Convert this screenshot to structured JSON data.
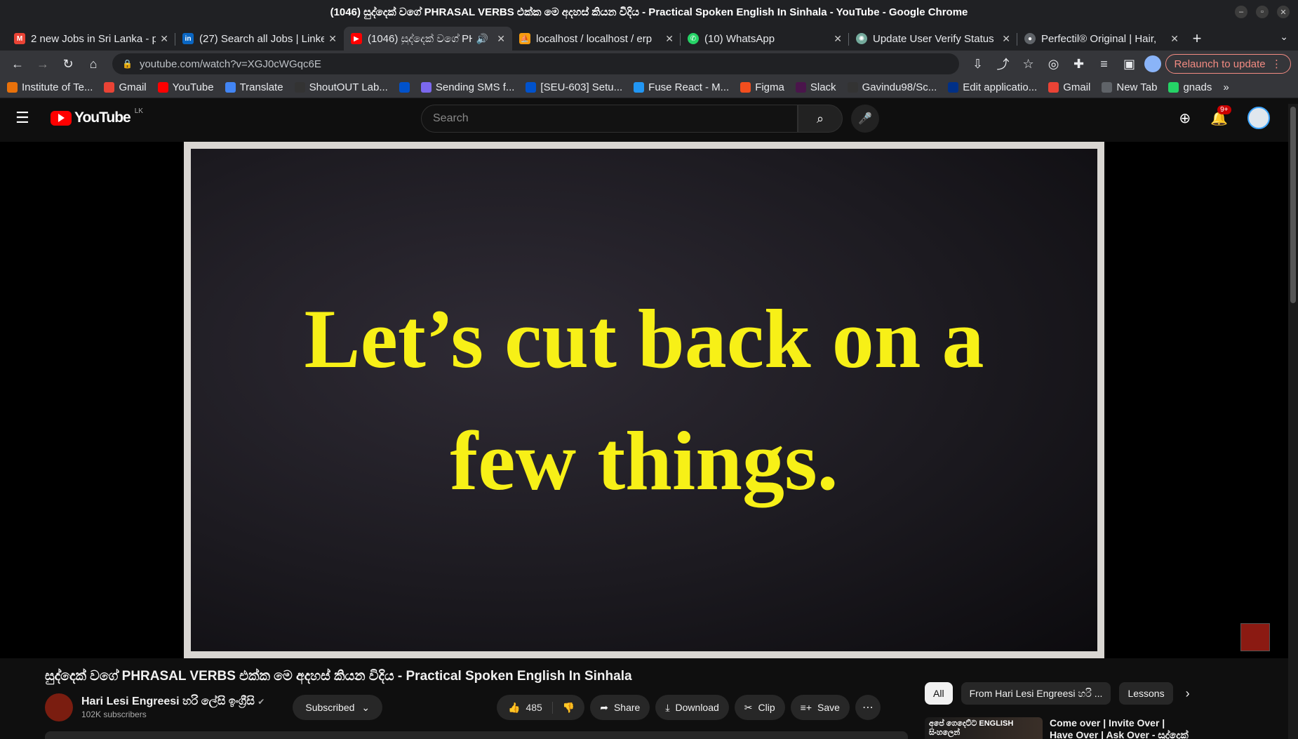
{
  "window": {
    "title": "(1046) සුද්දෙක් වගේ PHRASAL VERBS එක්ක මෙ අදහස් කියන විදිය - Practical Spoken English In Sinhala - YouTube - Google Chrome"
  },
  "tabs": [
    {
      "label": "2 new Jobs in Sri Lanka - p",
      "icon": "gmail-icon",
      "color": "#ea4335"
    },
    {
      "label": "(27) Search all Jobs | Linke",
      "icon": "linkedin-icon",
      "color": "#0a66c2"
    },
    {
      "label": "(1046) සුද්දෙක් වගේ PH",
      "icon": "youtube-icon",
      "color": "#ff0000",
      "active": true
    },
    {
      "label": "localhost / localhost / erp",
      "icon": "phpmyadmin-icon",
      "color": "#f89c0e"
    },
    {
      "label": "(10) WhatsApp",
      "icon": "whatsapp-icon",
      "color": "#25d366"
    },
    {
      "label": "Update User Verify Status",
      "icon": "chatgpt-icon",
      "color": "#74aa9c"
    },
    {
      "label": "Perfectil® Original | Hair,",
      "icon": "site-icon",
      "color": "#5f6368"
    }
  ],
  "toolbar": {
    "url": "youtube.com/watch?v=XGJ0cWGqc6E",
    "relaunch": "Relaunch to update"
  },
  "bookmarks": [
    {
      "label": "Institute of Te...",
      "icon": "in-icon",
      "color": "#e8710a"
    },
    {
      "label": "Gmail",
      "icon": "gmail-icon",
      "color": "#ea4335"
    },
    {
      "label": "YouTube",
      "icon": "youtube-icon",
      "color": "#ff0000"
    },
    {
      "label": "Translate",
      "icon": "translate-icon",
      "color": "#4285f4"
    },
    {
      "label": "ShoutOUT Lab...",
      "icon": "github-icon",
      "color": "#333333"
    },
    {
      "label": "",
      "icon": "atlassian-icon",
      "color": "#0052cc"
    },
    {
      "label": "Sending SMS f...",
      "icon": "diamond-icon",
      "color": "#7b68ee"
    },
    {
      "label": "[SEU-603] Setu...",
      "icon": "atlassian-icon",
      "color": "#0052cc"
    },
    {
      "label": "Fuse React - M...",
      "icon": "fuse-icon",
      "color": "#2196f3"
    },
    {
      "label": "Figma",
      "icon": "figma-icon",
      "color": "#f24e1e"
    },
    {
      "label": "Slack",
      "icon": "slack-icon",
      "color": "#4a154b"
    },
    {
      "label": "Gavindu98/Sc...",
      "icon": "github-icon",
      "color": "#333333"
    },
    {
      "label": "Edit applicatio...",
      "icon": "paypal-icon",
      "color": "#003087"
    },
    {
      "label": "Gmail",
      "icon": "gmail-icon",
      "color": "#ea4335"
    },
    {
      "label": "New Tab",
      "icon": "globe-icon",
      "color": "#5f6368"
    },
    {
      "label": "gnads",
      "icon": "whatsapp-icon",
      "color": "#25d366"
    }
  ],
  "youtube": {
    "logo_text": "YouTube",
    "country": "LK",
    "search_placeholder": "Search",
    "notifications": "9+"
  },
  "video": {
    "frame_text": "Let’s cut back on a few things.",
    "title": "සුද්දෙක් වගේ PHRASAL VERBS එක්ක මෙ අදහස් කියන විදිය - Practical Spoken English In Sinhala",
    "channel": "Hari Lesi Engreesi හරි ලේසි ඉංග්‍රීසි",
    "subscribers": "102K subscribers",
    "subscribe_label": "Subscribed",
    "likes": "485",
    "share": "Share",
    "download": "Download",
    "clip": "Clip",
    "save": "Save"
  },
  "sidebar": {
    "chips": [
      "All",
      "From Hari Lesi Engreesi හරි ...",
      "Lessons"
    ],
    "recommendation": {
      "thumb_text": "අපේ ගෙදෙට්ට ENGLISH සිංහලෙන්",
      "title": "Come over | Invite Over | Have Over | Ask Over - සුද්දෙක් වගේ"
    }
  }
}
